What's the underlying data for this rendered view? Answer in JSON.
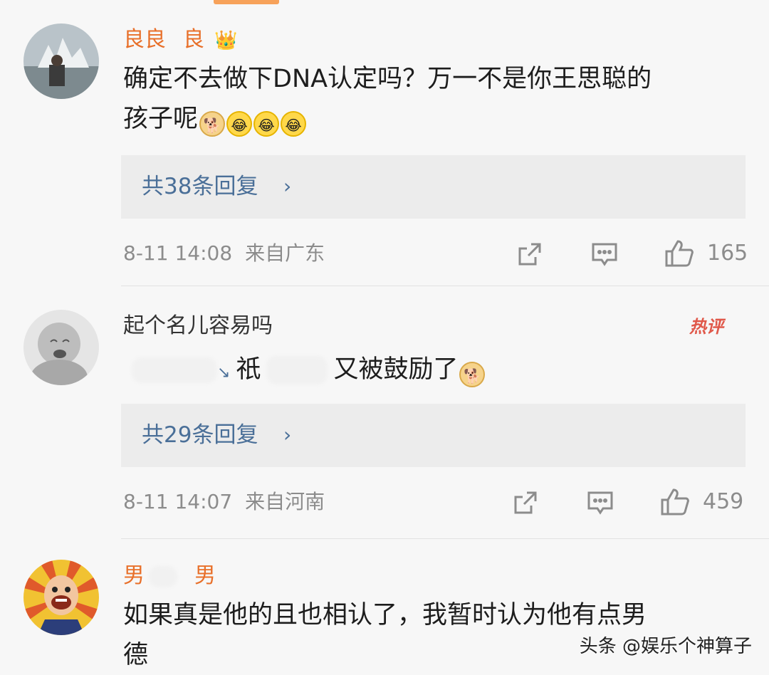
{
  "comments": [
    {
      "username": "良良",
      "username_extra": "良",
      "text_line1": "确定不去做下DNA认定吗？万一不是你王思聪的",
      "text_line2": "孩子呢",
      "replies_label": "共38条回复",
      "timestamp": "8-11 14:08",
      "location": "来自广东",
      "likes": "165"
    },
    {
      "username": "起个名儿容易吗",
      "hot_badge": "热评",
      "text_part1": "↘",
      "text_part2": "祇",
      "text_part3": "又被鼓励了",
      "replies_label": "共29条回复",
      "timestamp": "8-11 14:07",
      "location": "来自河南",
      "likes": "459"
    },
    {
      "username": "男",
      "username_extra": "男",
      "text_line1": "如果真是他的且也相认了，我暂时认为他有点男",
      "text_line2": "德"
    }
  ],
  "watermark": "头条 @娱乐个神算子",
  "colors": {
    "name_orange": "#e8702a",
    "link_blue": "#4a6f98",
    "hot_red": "#e0584a",
    "meta_gray": "#8c8c8c"
  },
  "icons": [
    "repost-icon",
    "comment-icon",
    "like-icon",
    "chevron-right-icon",
    "crown-badge-icon"
  ]
}
